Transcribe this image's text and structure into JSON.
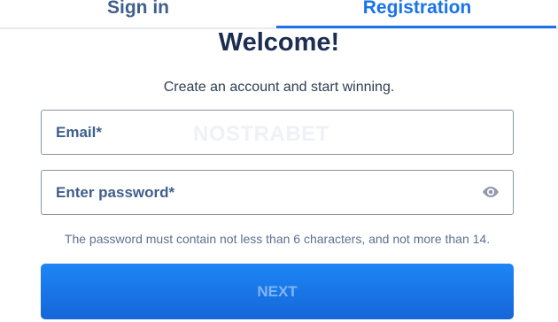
{
  "tabs": {
    "signin_label": "Sign in",
    "registration_label": "Registration",
    "active": "registration"
  },
  "heading": {
    "title": "Welcome!",
    "subtitle": "Create an account and start winning."
  },
  "form": {
    "email_label": "Email*",
    "email_value": "",
    "password_label": "Enter password*",
    "password_value": "",
    "password_hint": "The password must contain not less than 6 characters, and not more than 14.",
    "submit_label": "NEXT"
  },
  "watermark": "NOSTRABET",
  "colors": {
    "accent": "#1a73e8",
    "title": "#1c2d52",
    "label": "#3f5f8c",
    "border": "#8a93a6",
    "button": "#1e86f5"
  },
  "icons": {
    "password_toggle": "eye-icon"
  }
}
